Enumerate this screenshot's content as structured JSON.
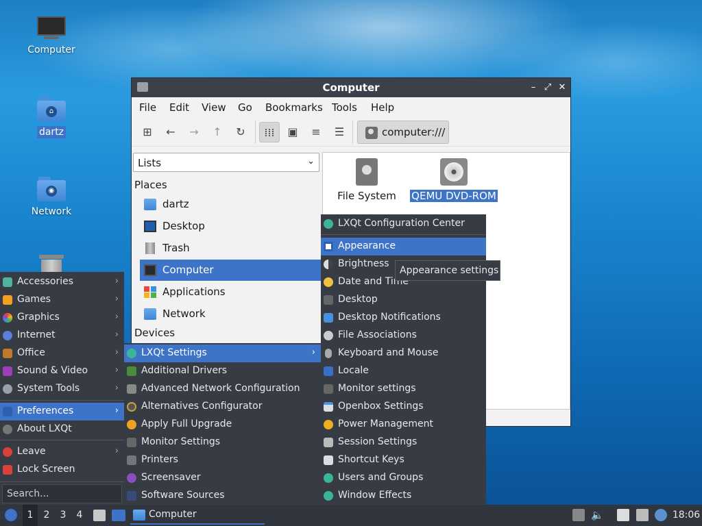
{
  "desktop": {
    "icons": [
      {
        "label": "Computer",
        "icon": "computer-icon"
      },
      {
        "label": "dartz",
        "icon": "home-folder-icon"
      },
      {
        "label": "Network",
        "icon": "network-folder-icon"
      },
      {
        "label": "",
        "icon": "trash-icon"
      }
    ]
  },
  "window": {
    "title": "Computer",
    "menubar": [
      "File",
      "Edit",
      "View",
      "Go",
      "Bookmarks",
      "Tools",
      "Help"
    ],
    "path": "computer:///",
    "side_combo": "Lists",
    "places_heading": "Places",
    "places": [
      "dartz",
      "Desktop",
      "Trash",
      "Computer",
      "Applications",
      "Network"
    ],
    "devices_heading": "Devices",
    "files": [
      "File System",
      "QEMU DVD-ROM"
    ]
  },
  "main_menu": {
    "categories": [
      "Accessories",
      "Games",
      "Graphics",
      "Internet",
      "Office",
      "Sound & Video",
      "System Tools"
    ],
    "preferences": "Preferences",
    "about": "About LXQt",
    "leave": "Leave",
    "lock": "Lock Screen",
    "search_placeholder": "Search..."
  },
  "preferences_menu": {
    "items": [
      "LXQt Settings",
      "Additional Drivers",
      "Advanced Network Configuration",
      "Alternatives Configurator",
      "Apply Full Upgrade",
      "Monitor Settings",
      "Printers",
      "Screensaver",
      "Software Sources"
    ]
  },
  "lxqt_settings_menu": {
    "items": [
      "LXQt Configuration Center",
      "Appearance",
      "Brightness",
      "Date and Time",
      "Desktop",
      "Desktop Notifications",
      "File Associations",
      "Keyboard and Mouse",
      "Locale",
      "Monitor settings",
      "Openbox Settings",
      "Power Management",
      "Session Settings",
      "Shortcut Keys",
      "Users and Groups",
      "Window Effects"
    ]
  },
  "tooltip": "Appearance settings",
  "taskbar": {
    "workspaces": [
      "1",
      "2",
      "3",
      "4"
    ],
    "task": "Computer",
    "clock": "18:06"
  },
  "colors": {
    "selection": "#3d74c7",
    "menu_bg": "#373b44",
    "taskbar_bg": "#31353e"
  }
}
